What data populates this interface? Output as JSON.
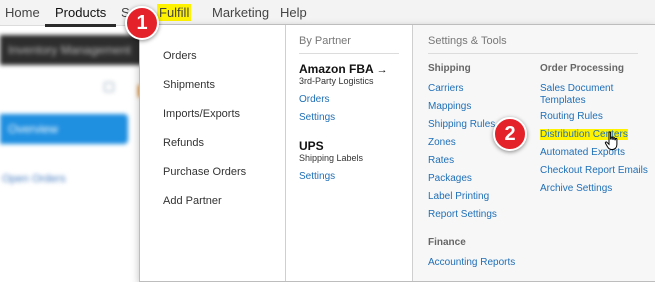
{
  "nav": {
    "home": "Home",
    "products": "Products",
    "hidden_item_partial": "S",
    "fulfill": "Fulfill",
    "marketing": "Marketing",
    "help": "Help"
  },
  "background": {
    "header_text": "Inventory Management",
    "sidebar_text": "Overview",
    "sidebar_link": "Open Orders"
  },
  "menu": {
    "actions": [
      "Orders",
      "Shipments",
      "Imports/Exports",
      "Refunds",
      "Purchase Orders",
      "Add Partner"
    ],
    "by_partner": {
      "title": "By Partner",
      "partners": [
        {
          "name": "Amazon FBA",
          "arrow": "→",
          "subtitle": "3rd-Party Logistics",
          "links": [
            "Orders",
            "Settings"
          ]
        },
        {
          "name": "UPS",
          "subtitle": "Shipping Labels",
          "links": [
            "Settings"
          ]
        }
      ]
    },
    "settings_tools": {
      "title": "Settings & Tools",
      "shipping": {
        "heading": "Shipping",
        "links": [
          "Carriers",
          "Mappings",
          "Shipping Rules",
          "Zones",
          "Rates",
          "Packages",
          "Label Printing",
          "Report Settings"
        ]
      },
      "finance": {
        "heading": "Finance",
        "links": [
          "Accounting Reports"
        ]
      },
      "order_processing": {
        "heading": "Order Processing",
        "links": [
          "Sales Document Templates",
          "Routing Rules",
          "Distribution Centers",
          "Automated Exports",
          "Checkout Report Emails",
          "Archive Settings"
        ]
      }
    }
  },
  "callouts": {
    "one": "1",
    "two": "2"
  },
  "colors": {
    "highlight": "#fff200",
    "link": "#1f6fb7",
    "callout": "#e3222a"
  },
  "icons": {
    "cursor": "hand-pointer-icon"
  }
}
